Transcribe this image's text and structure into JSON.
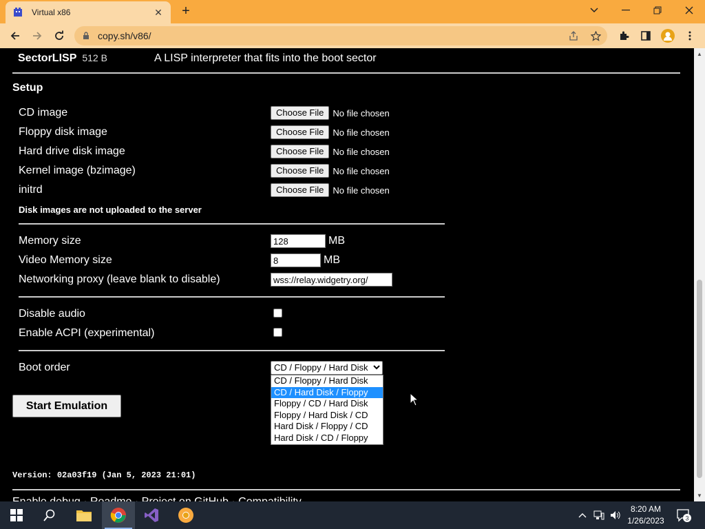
{
  "browser": {
    "tab_title": "Virtual x86",
    "url": "copy.sh/v86/"
  },
  "sector": {
    "name": "SectorLISP",
    "size": "512 B",
    "description": "A LISP interpreter that fits into the boot sector"
  },
  "setup": {
    "heading": "Setup",
    "file_inputs": [
      {
        "label": "CD image",
        "button": "Choose File",
        "status": "No file chosen"
      },
      {
        "label": "Floppy disk image",
        "button": "Choose File",
        "status": "No file chosen"
      },
      {
        "label": "Hard drive disk image",
        "button": "Choose File",
        "status": "No file chosen"
      },
      {
        "label": "Kernel image (bzimage)",
        "button": "Choose File",
        "status": "No file chosen"
      },
      {
        "label": "initrd",
        "button": "Choose File",
        "status": "No file chosen"
      }
    ],
    "upload_note": "Disk images are not uploaded to the server",
    "memory": {
      "label": "Memory size",
      "value": "128",
      "unit": "MB"
    },
    "video_memory": {
      "label": "Video Memory size",
      "value": "8",
      "unit": "MB"
    },
    "proxy": {
      "label": "Networking proxy (leave blank to disable)",
      "value": "wss://relay.widgetry.org/"
    },
    "disable_audio": {
      "label": "Disable audio",
      "checked": false
    },
    "enable_acpi": {
      "label": "Enable ACPI (experimental)",
      "checked": false
    },
    "boot_order": {
      "label": "Boot order",
      "selected": "CD / Floppy / Hard Disk",
      "options": [
        "CD / Floppy / Hard Disk",
        "CD / Hard Disk / Floppy",
        "Floppy / CD / Hard Disk",
        "Floppy / Hard Disk / CD",
        "Hard Disk / Floppy / CD",
        "Hard Disk / CD / Floppy"
      ],
      "highlighted_index": 1
    },
    "start_button": "Start Emulation"
  },
  "version": {
    "prefix": "Version: ",
    "hash": "02a03f19",
    "date": " (Jan 5, 2023 21:01)"
  },
  "footer_partial": "Enable debug · Readme · Project on GitHub · Compatibility",
  "taskbar": {
    "time": "8:20 AM",
    "date": "1/26/2023",
    "notification_count": "3"
  },
  "colors": {
    "chrome_accent": "#f9aa3f",
    "toolbar": "#fbd9a8",
    "page_bg": "#000000",
    "select_highlight": "#1e90ff",
    "taskbar": "#1f2733"
  }
}
